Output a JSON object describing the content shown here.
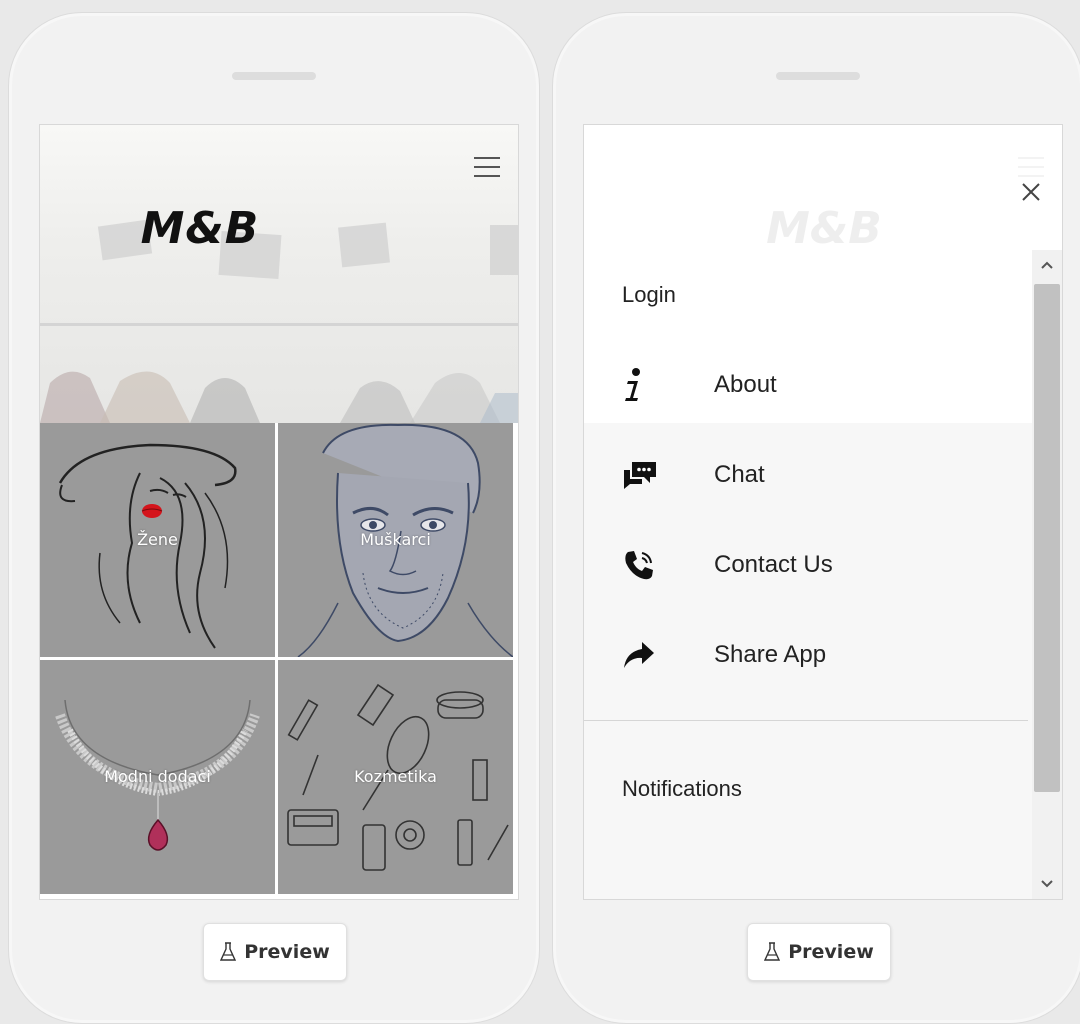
{
  "left_phone": {
    "header": {
      "title": "M&B",
      "menu_icon": "hamburger-icon"
    },
    "categories": [
      {
        "label": "Žene",
        "art": "woman-face-sketch"
      },
      {
        "label": "Muškarci",
        "art": "man-face-sketch"
      },
      {
        "label": "Modni dodaci",
        "art": "necklace-sketch"
      },
      {
        "label": "Kozmetika",
        "art": "cosmetics-sketch"
      }
    ],
    "preview_button": {
      "label": "Preview",
      "icon": "flask-icon"
    }
  },
  "right_phone": {
    "ghost_title": "M&B",
    "close_icon": "close-icon",
    "menu": {
      "login": "Login",
      "items": [
        {
          "label": "About",
          "icon": "info-icon"
        },
        {
          "label": "Chat",
          "icon": "chat-icon"
        },
        {
          "label": "Contact Us",
          "icon": "phone-icon"
        },
        {
          "label": "Share App",
          "icon": "share-icon"
        }
      ],
      "notifications": "Notifications"
    },
    "preview_button": {
      "label": "Preview",
      "icon": "flask-icon"
    }
  },
  "colors": {
    "tile_bg": "#9a9a9a",
    "text_dark": "#222222",
    "lip_red": "#d4141c",
    "pendant": "#b0305a"
  }
}
